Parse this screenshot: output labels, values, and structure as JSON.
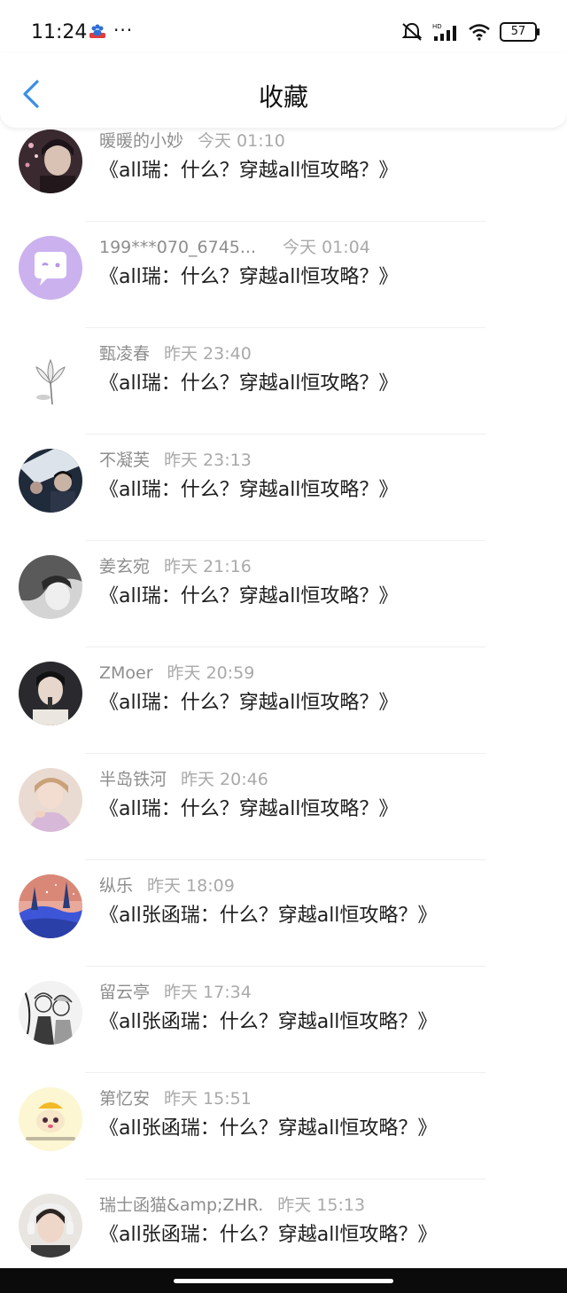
{
  "status_bar": {
    "time": "11:24",
    "more": "···",
    "hd": "HD",
    "battery": "57",
    "icons": [
      "app-badge-icon",
      "mute-bell-icon",
      "signal-icon",
      "wifi-icon",
      "battery-icon"
    ]
  },
  "header": {
    "title": "收藏",
    "back_icon": "chevron-left-icon",
    "accent": "#3a8ee6"
  },
  "items": [
    {
      "name": "暖暖的小妙",
      "time": "今天 01:10",
      "message": "《all瑞：什么？穿越all恒攻略？》"
    },
    {
      "name": "199***070_6745...",
      "time": "今天 01:04",
      "message": "《all瑞：什么？穿越all恒攻略？》"
    },
    {
      "name": "甄凌春",
      "time": "昨天 23:40",
      "message": "《all瑞：什么？穿越all恒攻略？》"
    },
    {
      "name": "不凝芙",
      "time": "昨天 23:13",
      "message": "《all瑞：什么？穿越all恒攻略？》"
    },
    {
      "name": "姜玄宛",
      "time": "昨天 21:16",
      "message": "《all瑞：什么？穿越all恒攻略？》"
    },
    {
      "name": "ZMoer",
      "time": "昨天 20:59",
      "message": "《all瑞：什么？穿越all恒攻略？》"
    },
    {
      "name": "半岛铁河",
      "time": "昨天 20:46",
      "message": "《all瑞：什么？穿越all恒攻略？》"
    },
    {
      "name": "纵乐",
      "time": "昨天 18:09",
      "message": "《all张函瑞：什么？穿越all恒攻略？》"
    },
    {
      "name": "留云亭",
      "time": "昨天 17:34",
      "message": "《all张函瑞：什么？穿越all恒攻略？》"
    },
    {
      "name": "第忆安",
      "time": "昨天 15:51",
      "message": "《all张函瑞：什么？穿越all恒攻略？》"
    },
    {
      "name": "瑞士函猫&amp;ZHR.",
      "time": "昨天 15:13",
      "message": "《all张函瑞：什么？穿越all恒攻略？》"
    }
  ]
}
